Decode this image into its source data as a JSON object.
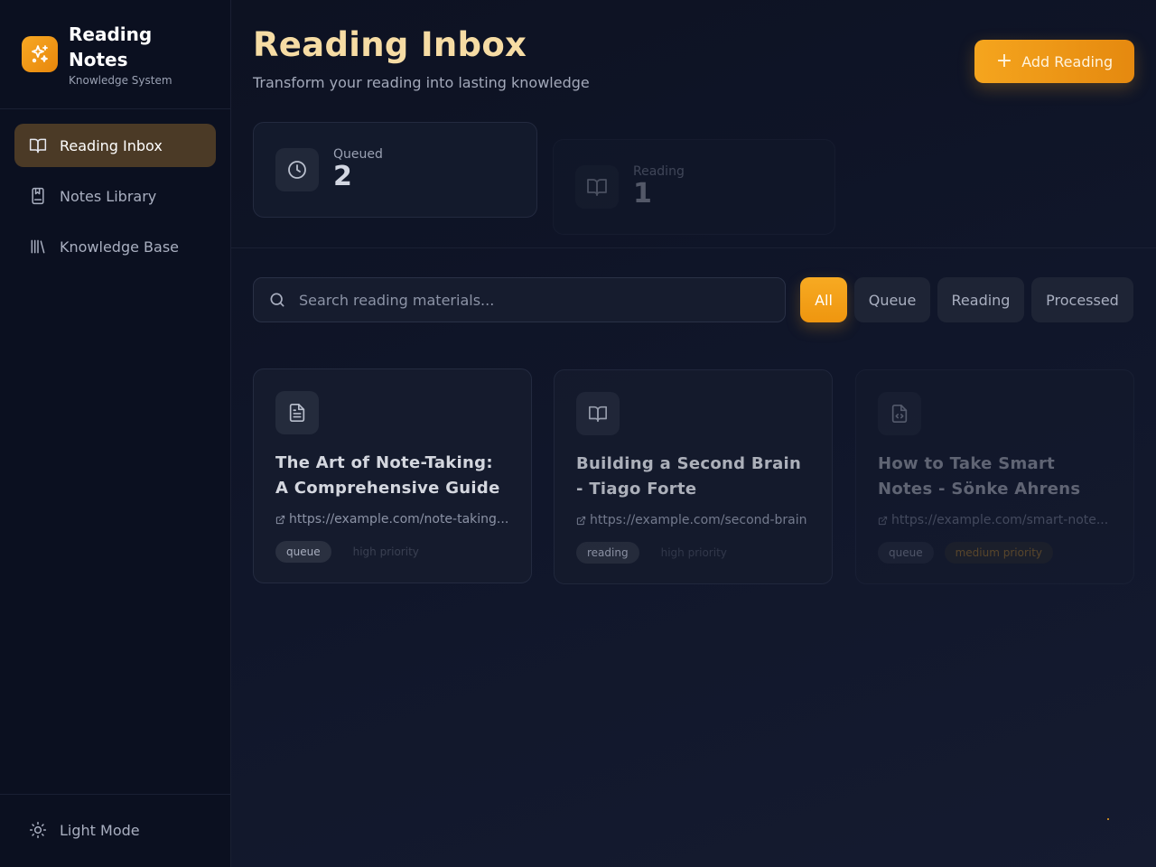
{
  "brand": {
    "title": "Reading Notes",
    "subtitle": "Knowledge System",
    "icon": "sparkles-icon",
    "color": "#f5a51e"
  },
  "sidebar": {
    "items": [
      {
        "label": "Reading Inbox",
        "icon": "book-open-icon",
        "active": true
      },
      {
        "label": "Notes Library",
        "icon": "notebook-icon",
        "active": false
      },
      {
        "label": "Knowledge Base",
        "icon": "library-icon",
        "active": false
      }
    ],
    "theme_toggle": {
      "label": "Light Mode",
      "icon": "sun-icon"
    }
  },
  "header": {
    "title": "Reading Inbox",
    "subtitle": "Transform your reading into lasting knowledge",
    "add_button": "Add Reading"
  },
  "stats": [
    {
      "label": "Queued",
      "value": "2",
      "icon": "clock-icon"
    },
    {
      "label": "Reading",
      "value": "1",
      "icon": "book-open-icon"
    }
  ],
  "search": {
    "placeholder": "Search reading materials...",
    "value": ""
  },
  "filters": [
    {
      "label": "All",
      "active": true
    },
    {
      "label": "Queue",
      "active": false
    },
    {
      "label": "Reading",
      "active": false
    },
    {
      "label": "Processed",
      "active": false
    }
  ],
  "cards": [
    {
      "title": "The Art of Note-Taking: A Comprehensive Guide",
      "url": "https://example.com/note-taking...",
      "status": "queue",
      "priority": "high priority",
      "icon": "file-text-icon"
    },
    {
      "title": "Building a Second Brain - Tiago Forte",
      "url": "https://example.com/second-brain",
      "status": "reading",
      "priority": "high priority",
      "icon": "book-open-icon"
    },
    {
      "title": "How to Take Smart Notes - Sönke Ahrens",
      "url": "https://example.com/smart-note...",
      "status": "queue",
      "priority": "medium priority",
      "icon": "file-code-icon"
    }
  ]
}
